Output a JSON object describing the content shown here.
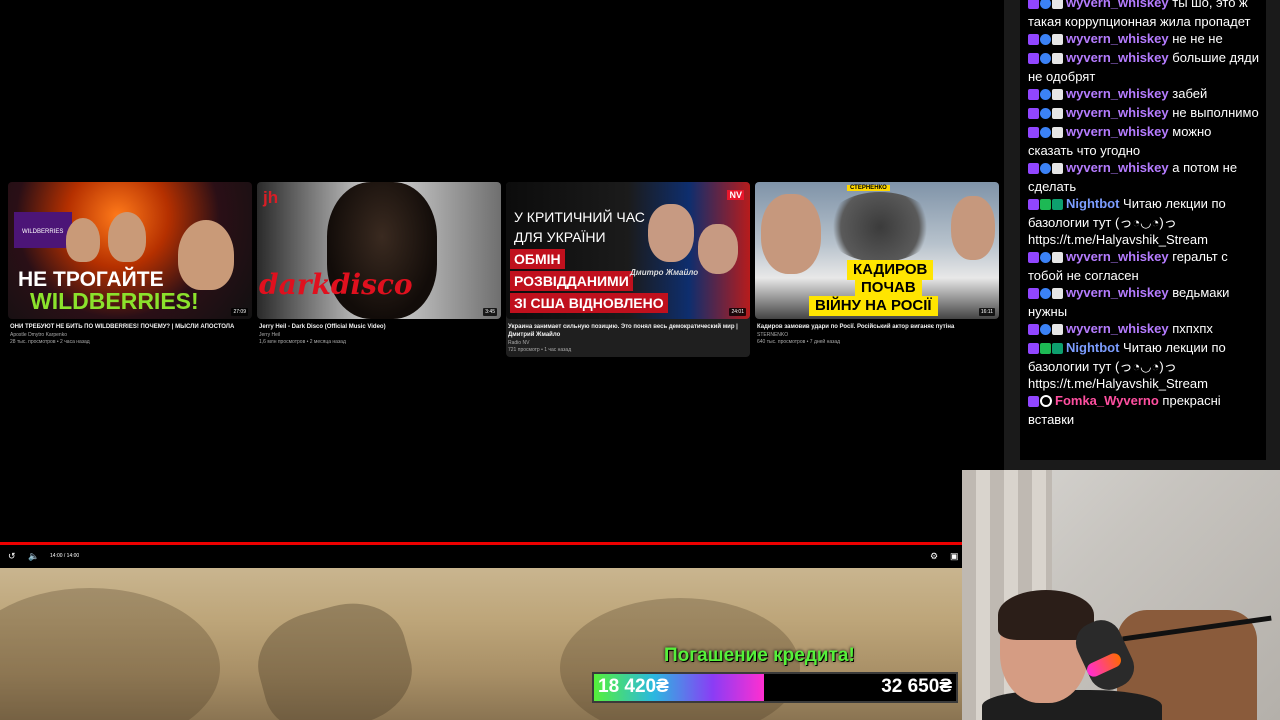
{
  "player": {
    "time_display": "14:00 / 14:00",
    "progress_fraction": 1.0,
    "accent_color": "#ee0000"
  },
  "end_screen": {
    "videos": [
      {
        "thumb_text": [
          "НЕ ТРОГАЙТЕ",
          "WILDBERRIES!"
        ],
        "duration": "27:09",
        "title": "ОНИ ТРЕБУЮТ НЕ БИТЬ ПО WILDBERRIES! ПОЧЕМУ? | МЫСЛИ АПОСТОЛА",
        "channel": "Apostle Dmytro Karpenko",
        "meta": "28 тыс. просмотров • 2 часа назад"
      },
      {
        "thumb_text": [
          "jh",
          "darkdisco"
        ],
        "duration": "3:45",
        "title": "Jerry Heil - Dark Disco (Official Music Video)",
        "channel": "Jerry Heil",
        "meta": "1,6 млн просмотров • 2 месяца назад"
      },
      {
        "thumb_text": [
          "У КРИТИЧНИЙ ЧАС",
          "ДЛЯ УКРАЇНИ",
          "ОБМІН",
          "РОЗВІДДАНИМИ",
          "ЗІ США ВІДНОВЛЕНО",
          "NV",
          "Дмитро Жмайло"
        ],
        "duration": "24:01",
        "title": "Украина занимает сильную позицию. Это понял весь демократический мир | Дмитрий Жмайло",
        "channel": "Radio NV",
        "meta": "721 просмотр • 1 час назад"
      },
      {
        "thumb_text": [
          "СТЕРНЕНКО",
          "КАДИРОВ",
          "ПОЧАВ",
          "ВІЙНУ НА РОСІЇ"
        ],
        "duration": "16:11",
        "title": "Кадиров замовив удари по Росії. Російський актор виганяє путіна",
        "channel": "STERNENKO",
        "meta": "640 тыс. просмотров • 7 дней назад"
      }
    ]
  },
  "credit": {
    "title": "Погашение кредита!",
    "current": "18 420₴",
    "goal": "32 650₴",
    "progress_fraction": 0.4696,
    "text_color": "#56f03a"
  },
  "chat": {
    "messages": [
      {
        "badges": [
          "sub",
          "blue",
          "white"
        ],
        "user": "wyvern_whiskey",
        "color": "#b57cff",
        "text": "ты шо, это ж такая коррупционная жила пропадет"
      },
      {
        "badges": [
          "sub",
          "blue",
          "white"
        ],
        "user": "wyvern_whiskey",
        "color": "#b57cff",
        "text": "не не не"
      },
      {
        "badges": [
          "sub",
          "blue",
          "white"
        ],
        "user": "wyvern_whiskey",
        "color": "#b57cff",
        "text": "большие дяди не одобрят"
      },
      {
        "badges": [
          "sub",
          "blue",
          "white"
        ],
        "user": "wyvern_whiskey",
        "color": "#b57cff",
        "text": "забей"
      },
      {
        "badges": [
          "sub",
          "blue",
          "white"
        ],
        "user": "wyvern_whiskey",
        "color": "#b57cff",
        "text": "не выполнимо"
      },
      {
        "badges": [
          "sub",
          "blue",
          "white"
        ],
        "user": "wyvern_whiskey",
        "color": "#b57cff",
        "text": "можно сказать что угодно"
      },
      {
        "badges": [
          "sub",
          "blue",
          "white"
        ],
        "user": "wyvern_whiskey",
        "color": "#b57cff",
        "text": "а потом не сделать"
      },
      {
        "badges": [
          "sub",
          "green",
          "robot"
        ],
        "user": "Nightbot",
        "color": "#7c9dff",
        "text": "Читаю лекции по базологии тут (っ◔◡◔)っ https://t.me/Halyavshik_Stream"
      },
      {
        "badges": [
          "sub",
          "blue",
          "white"
        ],
        "user": "wyvern_whiskey",
        "color": "#b57cff",
        "text": "геральт с тобой не согласен"
      },
      {
        "badges": [
          "sub",
          "blue",
          "white"
        ],
        "user": "wyvern_whiskey",
        "color": "#b57cff",
        "text": "ведьмаки нужны"
      },
      {
        "badges": [
          "sub",
          "blue",
          "white"
        ],
        "user": "wyvern_whiskey",
        "color": "#b57cff",
        "text": "пхпхпх"
      },
      {
        "badges": [
          "sub",
          "green",
          "robot"
        ],
        "user": "Nightbot",
        "color": "#7c9dff",
        "text": "Читаю лекции по базологии тут (っ◔◡◔)っ https://t.me/Halyavshik_Stream"
      },
      {
        "badges": [
          "sub",
          "circle"
        ],
        "user": "Fomka_Wyverno",
        "color": "#ff4fa0",
        "text": "прекрасні вставки"
      }
    ]
  }
}
